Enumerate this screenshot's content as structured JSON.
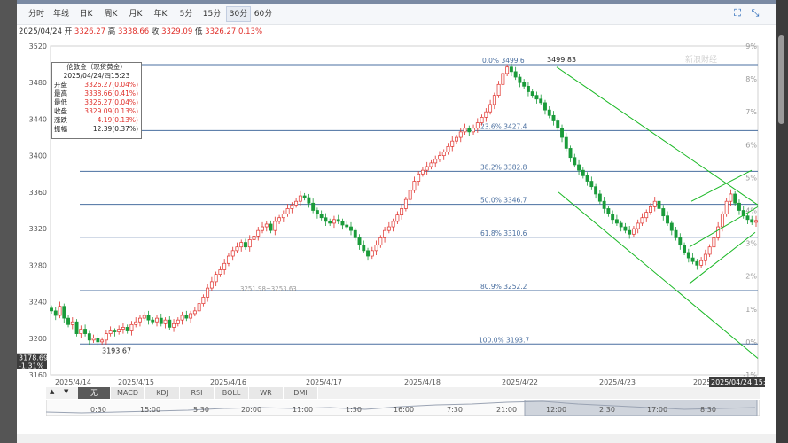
{
  "toolbar": {
    "tabs": [
      {
        "label": "分时",
        "active": false
      },
      {
        "label": "年线",
        "active": false
      },
      {
        "label": "日K",
        "active": false
      },
      {
        "label": "周K",
        "active": false
      },
      {
        "label": "月K",
        "active": false
      },
      {
        "label": "年K",
        "active": false
      },
      {
        "label": "5分",
        "active": false
      },
      {
        "label": "15分",
        "active": false
      },
      {
        "label": "30分",
        "active": true
      },
      {
        "label": "60分",
        "active": false
      }
    ],
    "icons": [
      "fullscreen-icon",
      "collapse-icon"
    ]
  },
  "quote": {
    "date": "2025/04/24",
    "open_label": "开",
    "open": "3326.27",
    "high_label": "高",
    "high": "3338.66",
    "close_label": "收",
    "close": "3329.09",
    "low_label": "低",
    "low": "3326.27",
    "change_pct": "0.13%"
  },
  "info_box": {
    "title": "伦敦金（现货黄金）",
    "datetime": "2025/04/24/四15:23",
    "rows": [
      {
        "label": "开盘",
        "value": "3326.27(0.04%)",
        "color": "red"
      },
      {
        "label": "最高",
        "value": "3338.66(0.41%)",
        "color": "red"
      },
      {
        "label": "最低",
        "value": "3326.27(0.04%)",
        "color": "red"
      },
      {
        "label": "收盘",
        "value": "3329.09(0.13%)",
        "color": "red"
      },
      {
        "label": "涨跌",
        "value": "4.19(0.13%)",
        "color": "red"
      },
      {
        "label": "振幅",
        "value": "12.39(0.37%)",
        "color": "dark"
      }
    ]
  },
  "watermark": "新浪财经",
  "indicators": {
    "tabs": [
      "无",
      "MACD",
      "KDJ",
      "RSI",
      "BOLL",
      "WR",
      "DMI"
    ],
    "active": "无"
  },
  "navigator": {
    "times": [
      "0:30",
      "15:00",
      "5:30",
      "20:00",
      "11:00",
      "1:30",
      "16:00",
      "7:30",
      "21:00",
      "12:00",
      "2:30",
      "17:00",
      "8:30"
    ]
  },
  "colors": {
    "up": "#e0312c",
    "down": "#1a9b3a",
    "fib_line": "#4a6fa0",
    "channel": "#19b824",
    "axis_text": "#555555"
  },
  "chart_data": {
    "type": "candlestick",
    "title": "",
    "ylim": [
      3160,
      3520
    ],
    "y_ticks": [
      3160,
      3200,
      3240,
      3280,
      3320,
      3360,
      3400,
      3440,
      3480,
      3520
    ],
    "right_pct_ticks": [
      "9%",
      "8%",
      "7%",
      "6%",
      "5%",
      "4%",
      "3%",
      "2%",
      "1%",
      "0%",
      "-1%"
    ],
    "x_labels": [
      "2025/4/14",
      "2025/4/15",
      "2025/4/16",
      "2025/4/17",
      "2025/4/18",
      "2025/4/22",
      "2025/4/23",
      "2025/4/2"
    ],
    "cursor_x_label": "2025/04/24 15:23",
    "cursor_y_label": "3178.69",
    "cursor_y_pct": "-1.31%",
    "high_marker": "3499.83",
    "low_marker": "3193.67",
    "fib_levels": [
      {
        "label": "0.0% 3499.6",
        "price": 3499.6
      },
      {
        "label": "23.6% 3427.4",
        "price": 3427.4
      },
      {
        "label": "38.2% 3382.8",
        "price": 3382.8
      },
      {
        "label": "50.0% 3346.7",
        "price": 3346.7
      },
      {
        "label": "61.8% 3310.6",
        "price": 3310.6
      },
      {
        "label": "80.9% 3252.2",
        "price": 3252.2
      },
      {
        "label": "100.0% 3193.7",
        "price": 3193.7
      }
    ],
    "annotation": "3251.98~3253.63",
    "closes": [
      3230,
      3225,
      3235,
      3222,
      3215,
      3218,
      3205,
      3210,
      3205,
      3198,
      3200,
      3196,
      3198,
      3205,
      3208,
      3207,
      3210,
      3212,
      3208,
      3215,
      3218,
      3222,
      3225,
      3220,
      3218,
      3222,
      3216,
      3220,
      3212,
      3216,
      3220,
      3225,
      3222,
      3227,
      3230,
      3238,
      3245,
      3255,
      3262,
      3270,
      3275,
      3282,
      3290,
      3296,
      3300,
      3305,
      3300,
      3308,
      3312,
      3318,
      3322,
      3325,
      3318,
      3328,
      3332,
      3336,
      3342,
      3346,
      3350,
      3356,
      3354,
      3348,
      3340,
      3336,
      3332,
      3328,
      3326,
      3330,
      3328,
      3324,
      3322,
      3318,
      3310,
      3302,
      3296,
      3290,
      3296,
      3302,
      3310,
      3318,
      3322,
      3328,
      3335,
      3342,
      3352,
      3362,
      3372,
      3380,
      3384,
      3388,
      3392,
      3396,
      3400,
      3404,
      3410,
      3416,
      3420,
      3426,
      3430,
      3426,
      3430,
      3436,
      3442,
      3448,
      3456,
      3466,
      3478,
      3490,
      3497,
      3492,
      3486,
      3480,
      3476,
      3470,
      3466,
      3462,
      3458,
      3450,
      3444,
      3438,
      3430,
      3420,
      3408,
      3398,
      3390,
      3384,
      3378,
      3372,
      3366,
      3358,
      3350,
      3342,
      3336,
      3330,
      3326,
      3322,
      3318,
      3314,
      3320,
      3326,
      3332,
      3338,
      3344,
      3350,
      3342,
      3334,
      3326,
      3318,
      3310,
      3302,
      3294,
      3288,
      3284,
      3280,
      3285,
      3292,
      3300,
      3310,
      3322,
      3336,
      3350,
      3358,
      3348,
      3340,
      3334,
      3330,
      3327,
      3329
    ],
    "ohlc_note": "closes approximated from the 30-minute candlestick chart"
  }
}
